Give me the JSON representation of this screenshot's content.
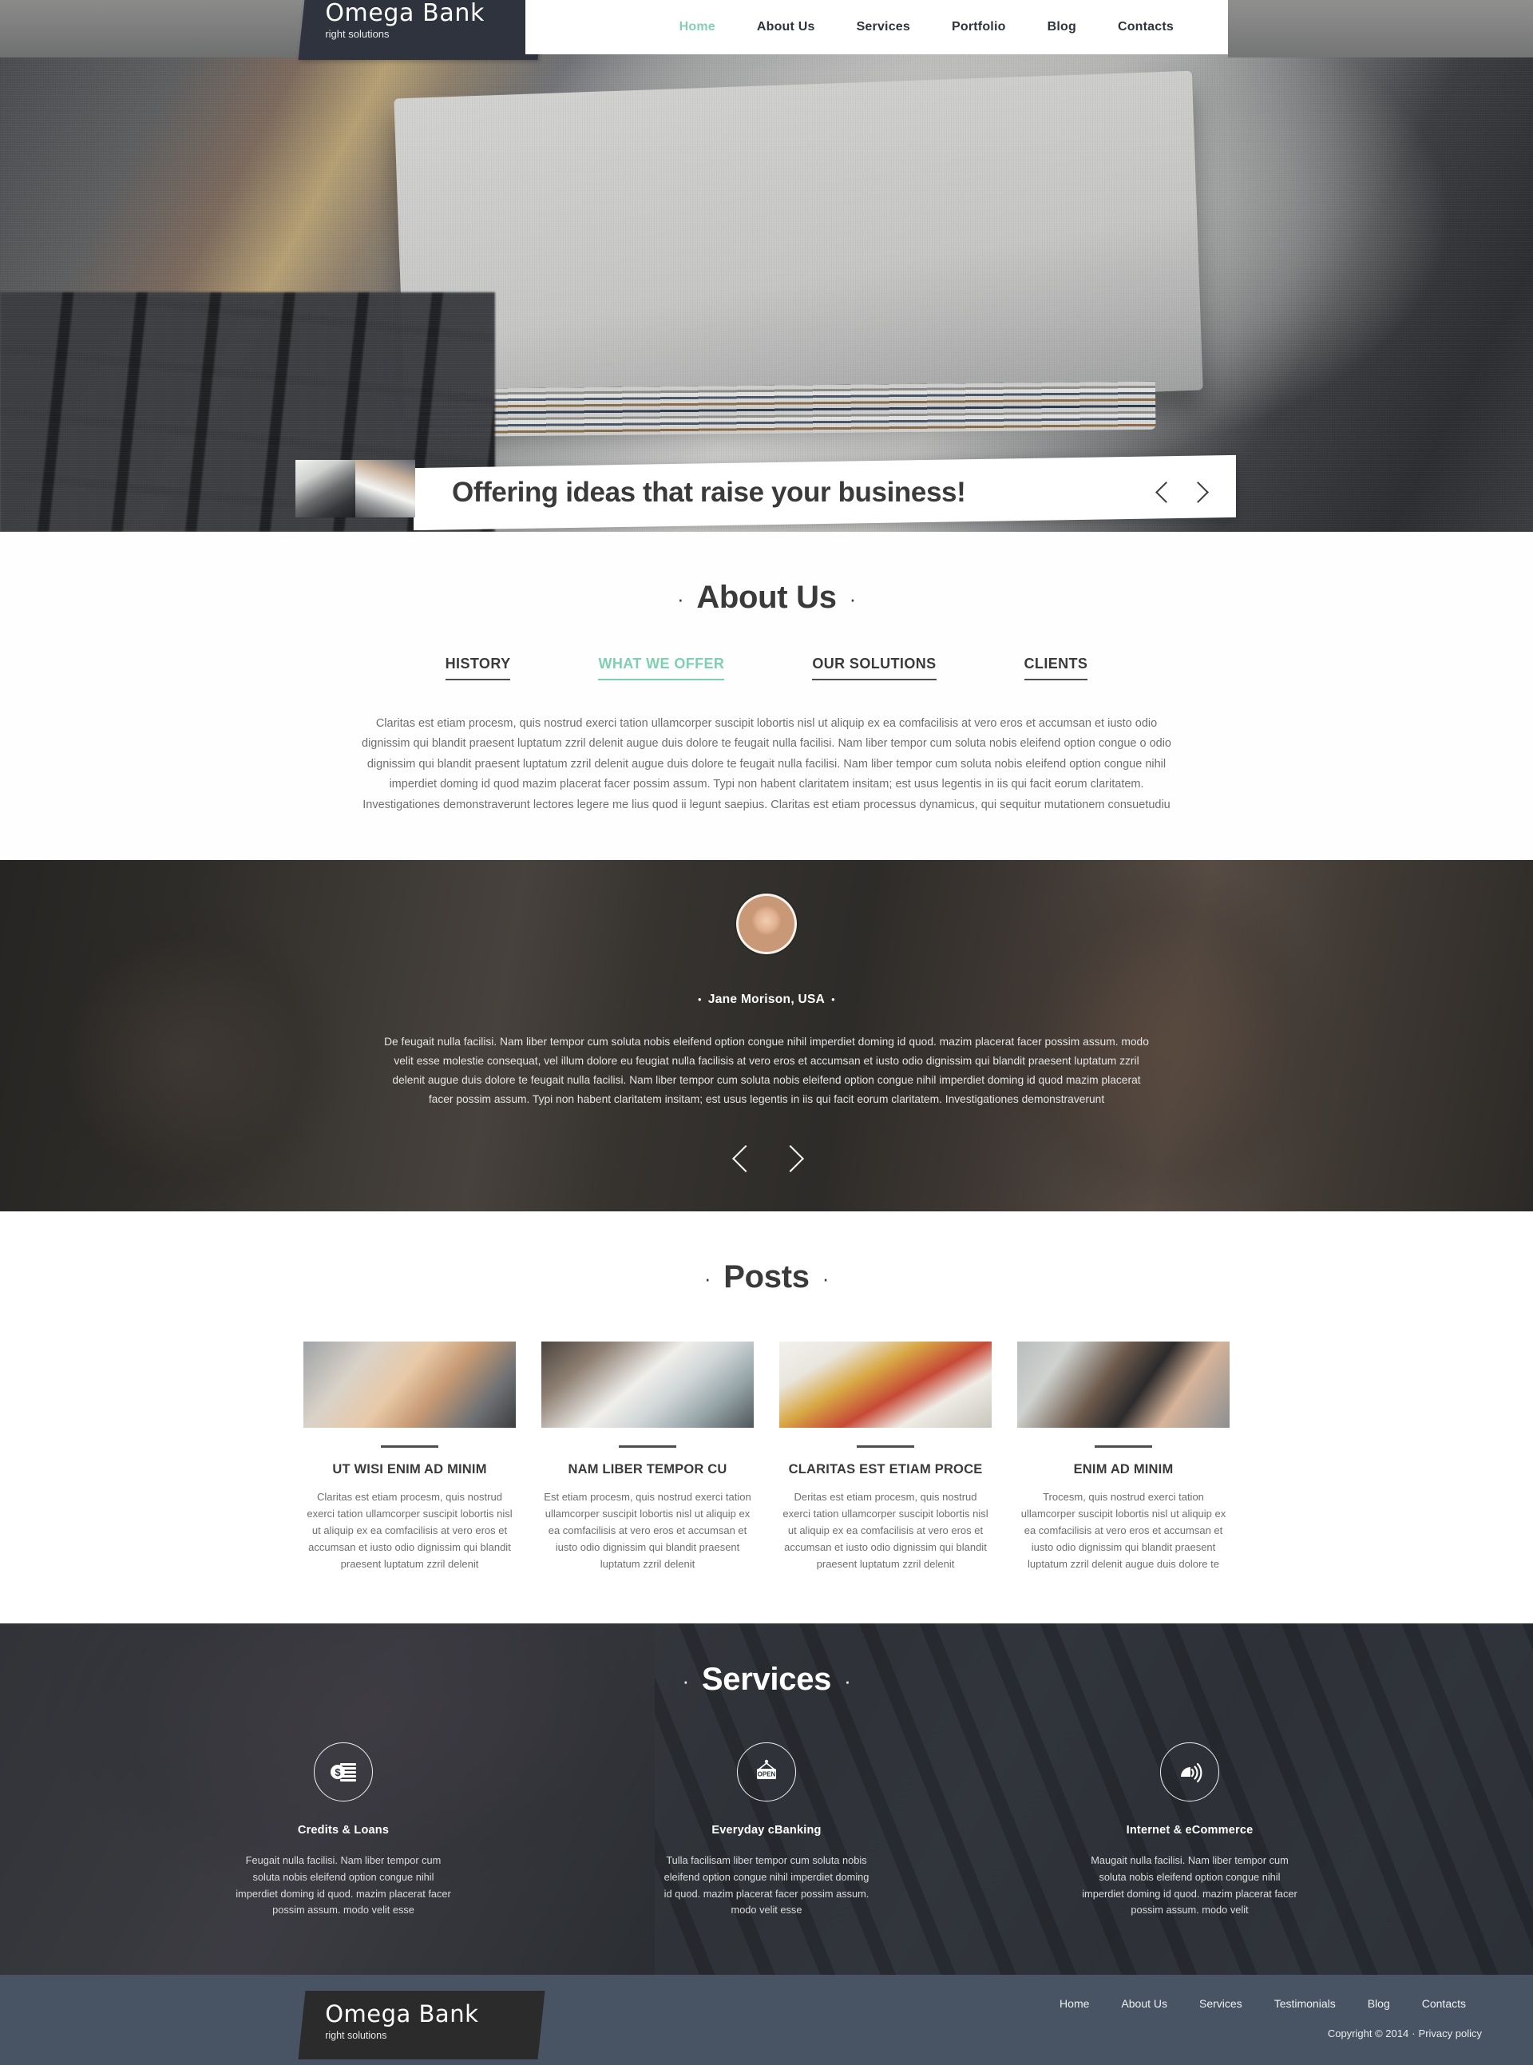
{
  "header": {
    "logo_title": "Omega Bank",
    "logo_tagline": "right solutions",
    "nav": [
      {
        "label": "Home",
        "active": true
      },
      {
        "label": "About Us",
        "active": false
      },
      {
        "label": "Services",
        "active": false
      },
      {
        "label": "Portfolio",
        "active": false
      },
      {
        "label": "Blog",
        "active": false
      },
      {
        "label": "Contacts",
        "active": false
      }
    ]
  },
  "hero": {
    "caption": "Offering ideas that raise your business!",
    "prev_icon": "chevron-left-icon",
    "next_icon": "chevron-right-icon"
  },
  "about": {
    "title": "About Us",
    "dot": "·",
    "tabs": [
      {
        "label": "HISTORY",
        "active": false
      },
      {
        "label": "WHAT WE OFFER",
        "active": true
      },
      {
        "label": "OUR SOLUTIONS",
        "active": false
      },
      {
        "label": "CLIENTS",
        "active": false
      }
    ],
    "body": "Claritas est etiam procesm, quis nostrud exerci tation ullamcorper suscipit lobortis nisl ut aliquip ex ea comfacilisis at vero eros et accumsan et iusto odio dignissim qui blandit praesent luptatum zzril delenit augue duis dolore te feugait nulla facilisi. Nam liber tempor cum soluta nobis eleifend option congue o odio dignissim qui blandit praesent luptatum zzril delenit augue duis dolore te feugait nulla facilisi. Nam liber tempor cum soluta nobis eleifend option congue nihil imperdiet doming id quod mazim placerat facer possim assum. Typi non habent claritatem insitam; est usus legentis in iis qui facit eorum claritatem. Investigationes demonstraverunt lectores legere me lius quod ii legunt saepius. Claritas est etiam processus dynamicus, qui sequitur mutationem consuetudiu"
  },
  "testimonial": {
    "avatar": "user-avatar",
    "name": "Jane Morison, USA",
    "bullet": "•",
    "text": "De feugait nulla facilisi. Nam liber tempor cum soluta nobis eleifend option congue nihil imperdiet doming id quod. mazim placerat facer possim assum. modo velit esse molestie consequat, vel illum dolore eu feugiat nulla facilisis at vero eros et accumsan et iusto odio dignissim qui blandit praesent luptatum zzril delenit augue duis dolore te feugait nulla facilisi. Nam liber tempor cum soluta nobis eleifend option congue nihil imperdiet doming id quod mazim placerat facer possim assum. Typi non habent claritatem insitam; est usus legentis in iis qui facit eorum claritatem. Investigationes demonstraverunt",
    "prev_icon": "chevron-left-icon",
    "next_icon": "chevron-right-icon"
  },
  "posts": {
    "title": "Posts",
    "dot": "·",
    "items": [
      {
        "thumb": "hand-typing-on-laptop-photo",
        "title": "UT WISI ENIM AD MINIM",
        "text": "Claritas est etiam procesm, quis nostrud exerci tation ullamcorper suscipit lobortis nisl ut aliquip ex ea comfacilisis at vero eros et accumsan et iusto odio dignissim qui blandit praesent luptatum zzril delenit"
      },
      {
        "thumb": "card-payment-terminal-photo",
        "title": "NAM LIBER TEMPOR CU",
        "text": "Est etiam procesm, quis nostrud exerci tation ullamcorper suscipit lobortis nisl ut aliquip ex ea comfacilisis at vero eros et accumsan et iusto odio dignissim qui blandit praesent luptatum zzril delenit"
      },
      {
        "thumb": "mortgage-documents-photo",
        "title": "CLARITAS EST ETIAM PROCE",
        "text": "Deritas est etiam procesm, quis nostrud exerci tation ullamcorper suscipit lobortis nisl ut aliquip ex ea comfacilisis at vero eros et accumsan et iusto odio dignissim qui blandit praesent luptatum zzril delenit"
      },
      {
        "thumb": "support-agent-headset-photo",
        "title": "ENIM AD MINIM",
        "text": "Trocesm, quis nostrud exerci tation ullamcorper suscipit lobortis nisl ut aliquip ex ea comfacilisis at vero eros et accumsan et iusto odio dignissim qui blandit praesent luptatum zzril delenit augue duis dolore te"
      }
    ]
  },
  "services": {
    "title": "Services",
    "dot": "·",
    "items": [
      {
        "icon": "money-stack-icon",
        "name": "Credits & Loans",
        "text": "Feugait nulla facilisi. Nam liber tempor cum soluta nobis eleifend option congue nihil imperdiet doming id quod. mazim placerat facer possim assum. modo velit esse"
      },
      {
        "icon": "open-sign-icon",
        "name": "Everyday cBanking",
        "text": "Tulla facilisam liber tempor cum soluta nobis eleifend option congue nihil imperdiet doming id quod. mazim placerat facer possim assum. modo velit esse"
      },
      {
        "icon": "wireless-click-icon",
        "name": "Internet & eCommerce",
        "text": "Maugait nulla facilisi. Nam liber tempor cum soluta nobis eleifend option congue nihil imperdiet doming id quod. mazim placerat facer possim assum. modo velit"
      }
    ]
  },
  "footer": {
    "logo_title": "Omega Bank",
    "logo_tagline": "right solutions",
    "nav": [
      {
        "label": "Home"
      },
      {
        "label": "About Us"
      },
      {
        "label": "Services"
      },
      {
        "label": "Testimonials"
      },
      {
        "label": "Blog"
      },
      {
        "label": "Contacts"
      }
    ],
    "copyright": "Copyright © 2014",
    "separator": "·",
    "privacy": "Privacy policy"
  },
  "colors": {
    "accent": "#84cfb3",
    "dark": "#2e333d",
    "footer_bg": "#485363",
    "text": "#3a3a3a",
    "muted": "#6d6e70"
  }
}
